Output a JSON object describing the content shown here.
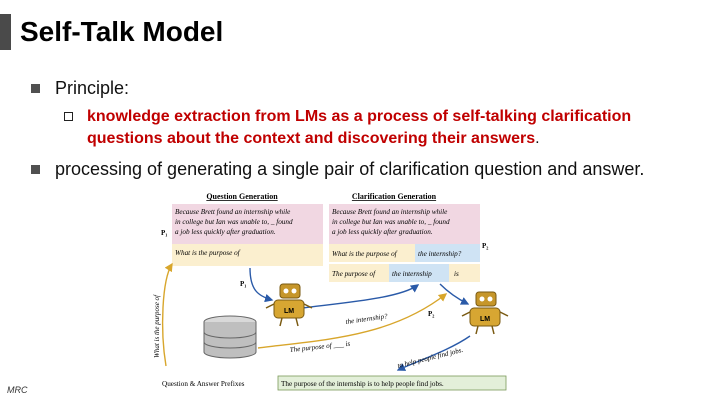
{
  "slide": {
    "title": "Self-Talk Model",
    "bullet1": "Principle:",
    "sub_bold": "knowledge extraction from LMs as a process of self-talking clarification questions about the context and discovering their answers",
    "sub_tail": ".",
    "bullet2": "processing of generating a single pair of clarification question and answer.",
    "footer": "MRC"
  },
  "figure": {
    "qg_title": "Question Generation",
    "cg_title": "Clarification Generation",
    "context_line1": "Because Brett found an internship while",
    "context_line2": "in college but Ian was unable to, _ found",
    "context_line3": "a job less quickly after graduation.",
    "p1_label": "P₁",
    "p2_label": "P₂",
    "qg_prompt": "What is the purpose of",
    "cg_prompt_q_prefix": "What is the purpose of",
    "cg_prompt_q_fill": "the internship?",
    "cg_prompt_a_prefix": "The purpose of",
    "cg_prompt_a_fill": "the internship",
    "cg_prompt_a_suffix": "is",
    "lm_label": "LM",
    "arrow_internship": "the internship?",
    "arrow_purpose": "The purpose of ___ is",
    "arrow_help": "to help people find jobs.",
    "vertical_label": "What is the purpose of",
    "prefix_label": "Question & Answer Prefixes",
    "final_answer": "The purpose of the internship is to help people find jobs."
  },
  "colors": {
    "pink": "#f1d7e2",
    "yellow": "#fbefcf",
    "blue": "#cfe3f4",
    "green": "#e3efd9",
    "red": "#c00000"
  }
}
